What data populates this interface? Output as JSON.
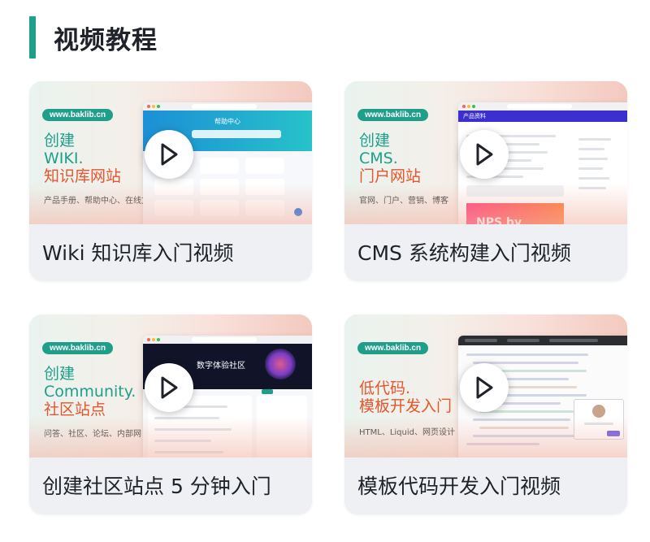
{
  "section": {
    "title": "视频教程"
  },
  "cards": [
    {
      "caption": "Wiki 知识库入门视频",
      "url_pill": "www.baklib.cn",
      "promo_lines": [
        "创建",
        "WIKI.",
        "知识库网站"
      ],
      "promo_sub": "产品手册、帮助中心、在线文档",
      "mock_title": "帮助中心"
    },
    {
      "caption": "CMS 系统构建入门视频",
      "url_pill": "www.baklib.cn",
      "promo_lines": [
        "创建",
        "CMS.",
        "门户网站"
      ],
      "promo_sub": "官网、门户、营销、博客",
      "mock_title": "产品资料",
      "mock_banner": "NPS by"
    },
    {
      "caption": "创建社区站点 5 分钟入门",
      "url_pill": "www.baklib.cn",
      "promo_lines": [
        "创建",
        "Community.",
        "社区站点"
      ],
      "promo_sub": "问答、社区、论坛、内部网",
      "mock_title": "数字体验社区"
    },
    {
      "caption": "模板代码开发入门视频",
      "url_pill": "www.baklib.cn",
      "promo_lines": [
        "低代码.",
        "模板开发入门"
      ],
      "promo_sub": "HTML、Liquid、网页设计"
    }
  ]
}
